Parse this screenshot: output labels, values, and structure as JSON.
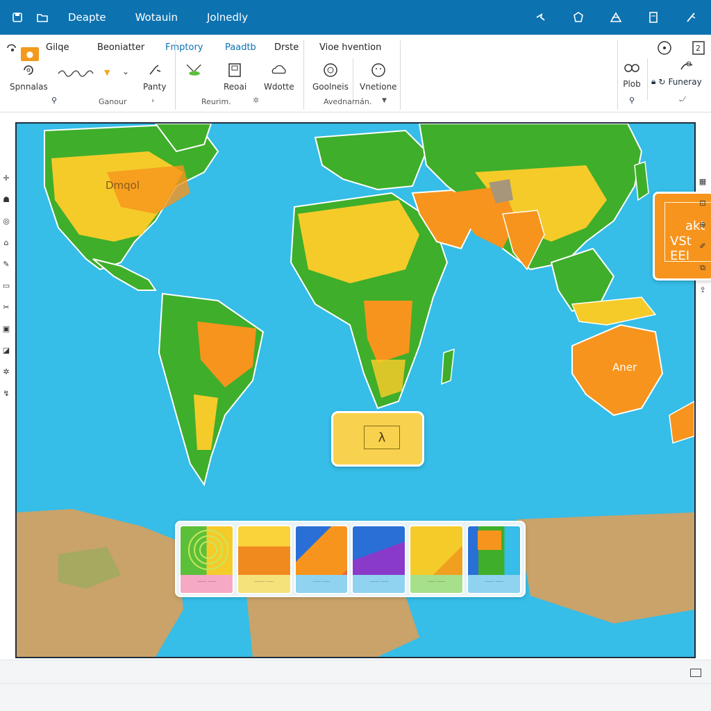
{
  "titlebar": {
    "menu": [
      "Deapte",
      "Wotauin",
      "Jolnedly"
    ],
    "left_icons": [
      "save-icon",
      "folder-icon"
    ],
    "right_icons": [
      "pin-icon",
      "dot",
      "hexagon-icon",
      "delta-icon",
      "doc-icon",
      "cursor-icon"
    ]
  },
  "ribbon": {
    "tabs": [
      "Gilqe",
      "Beoniatter",
      "Fmptory",
      "Paadtb",
      "Drste",
      "Vioe hvention"
    ],
    "active_tab": "Fmptory",
    "tools": {
      "spnnalas": "Spnnalas",
      "panty": "Panty",
      "reoai": "Reoai",
      "wdotte": "Wdotte",
      "goolneis": "Goolneis",
      "vnetione": "Vnetione",
      "plob": "Plob",
      "funeray": "Funeray"
    },
    "group_labels": {
      "ganour": "Ganour",
      "reurim": "Reurim.",
      "avednarnan": "Avednarnán."
    }
  },
  "map": {
    "labels": {
      "north_america": "Dmqol",
      "australia": "Aner"
    },
    "callout": {
      "line1": "akt",
      "line2": "VSt EEI"
    },
    "selection_symbol": "λ",
    "colors": {
      "ocean": "#36bde8",
      "green": "#3fae2a",
      "yellow": "#f5cb2a",
      "orange": "#f7941d",
      "tan": "#c9a36a"
    }
  },
  "tiles": [
    {
      "caption": "....... ......"
    },
    {
      "caption": "........ ......"
    },
    {
      "caption": "...... ......"
    },
    {
      "caption": "....... ......"
    },
    {
      "caption": "...... ......"
    },
    {
      "caption": "....... ......"
    }
  ]
}
